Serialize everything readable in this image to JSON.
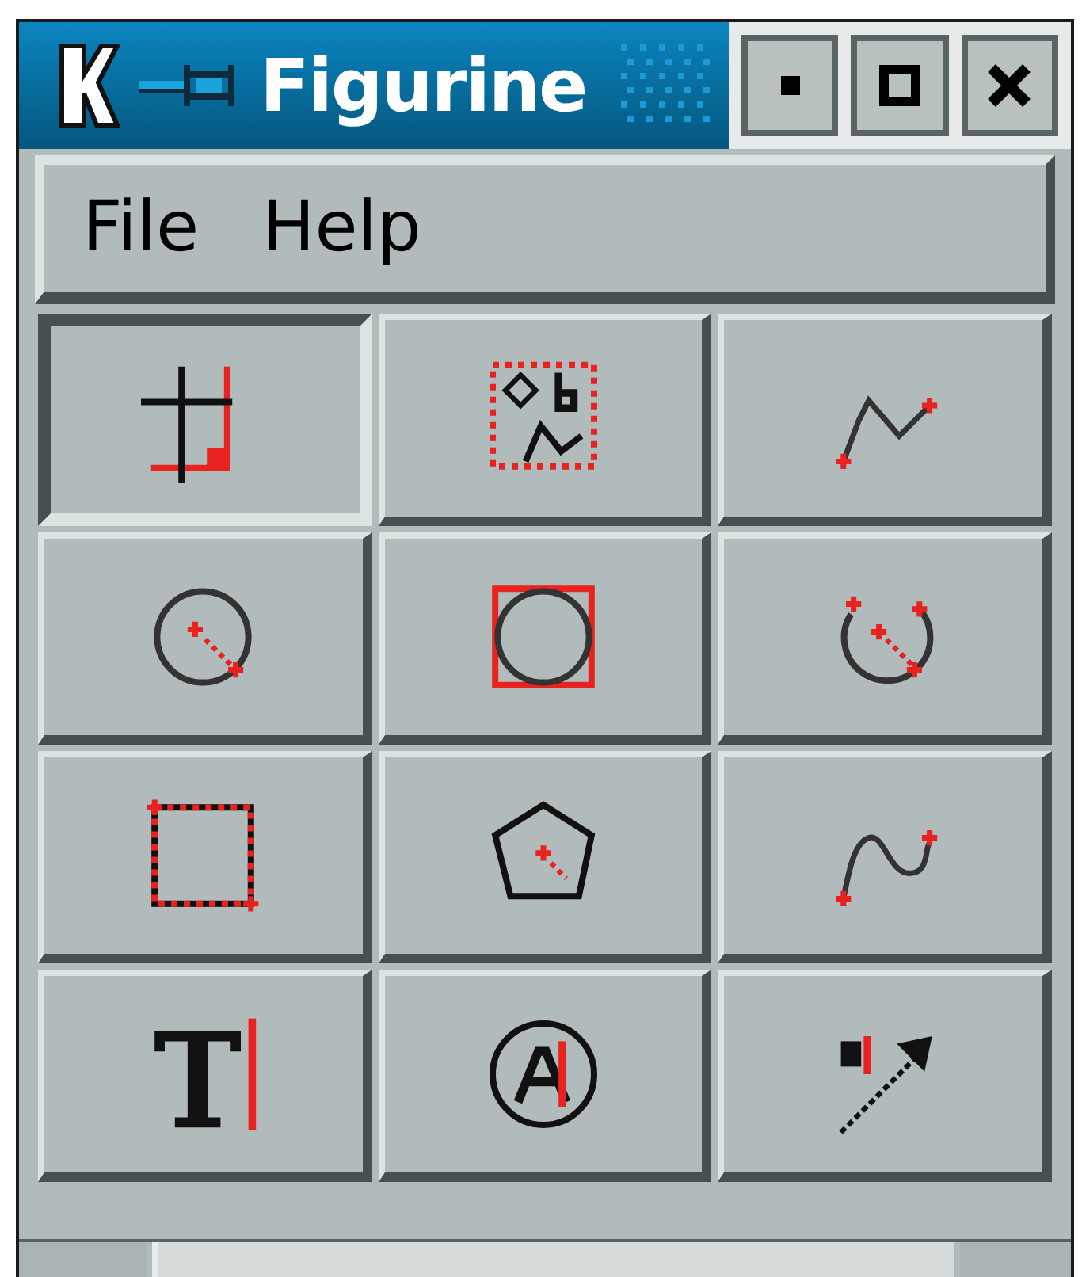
{
  "window": {
    "title": "Figurine"
  },
  "menu": [
    "File",
    "Help"
  ],
  "tools": [
    {
      "kind": "grid",
      "selected": true
    },
    {
      "kind": "select",
      "selected": false
    },
    {
      "kind": "polyline",
      "selected": false
    },
    {
      "kind": "circle",
      "selected": false
    },
    {
      "kind": "circle-box",
      "selected": false
    },
    {
      "kind": "arc",
      "selected": false
    },
    {
      "kind": "rectangle",
      "selected": false
    },
    {
      "kind": "polygon",
      "selected": false
    },
    {
      "kind": "curve",
      "selected": false
    },
    {
      "kind": "text",
      "selected": false
    },
    {
      "kind": "text-circle",
      "selected": false
    },
    {
      "kind": "arrow-label",
      "selected": false
    }
  ]
}
